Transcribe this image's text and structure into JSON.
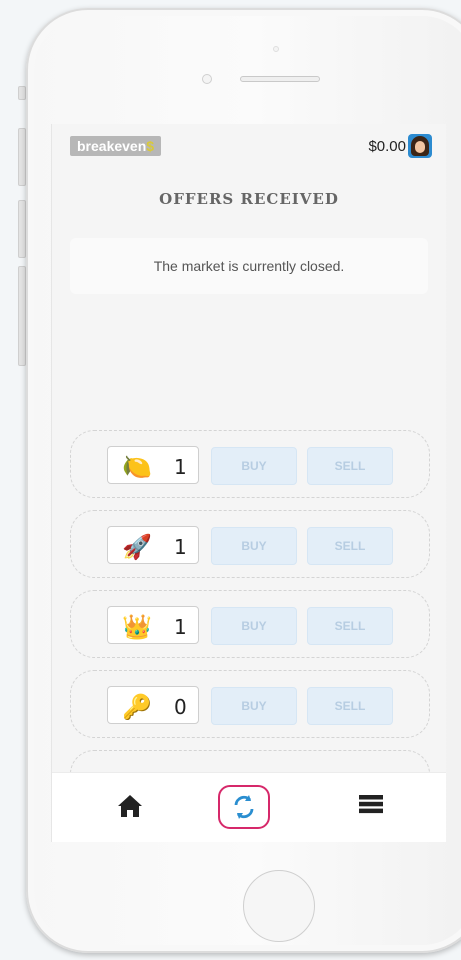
{
  "header": {
    "logo": "breakeven",
    "logo_accent": "$",
    "balance": "$0.00"
  },
  "page": {
    "title": "OFFERS RECEIVED",
    "notice": "The market is currently closed."
  },
  "offers": [
    {
      "icon": "lemon-icon",
      "emoji": "🍋",
      "quantity": "1",
      "buy": "BUY",
      "sell": "SELL"
    },
    {
      "icon": "rocket-icon",
      "emoji": "🚀",
      "quantity": "1",
      "buy": "BUY",
      "sell": "SELL"
    },
    {
      "icon": "crown-icon",
      "emoji": "👑",
      "quantity": "1",
      "buy": "BUY",
      "sell": "SELL"
    },
    {
      "icon": "key-icon",
      "emoji": "🔑",
      "quantity": "0",
      "buy": "BUY",
      "sell": "SELL"
    }
  ],
  "nav": {
    "items": [
      "home-icon",
      "sync-icon",
      "menu-icon"
    ],
    "active_highlight_color": "#d6286a"
  },
  "colors": {
    "button_bg": "#e3eef8",
    "button_text": "#b7cde2",
    "logo_bg": "#b7b7b7"
  }
}
